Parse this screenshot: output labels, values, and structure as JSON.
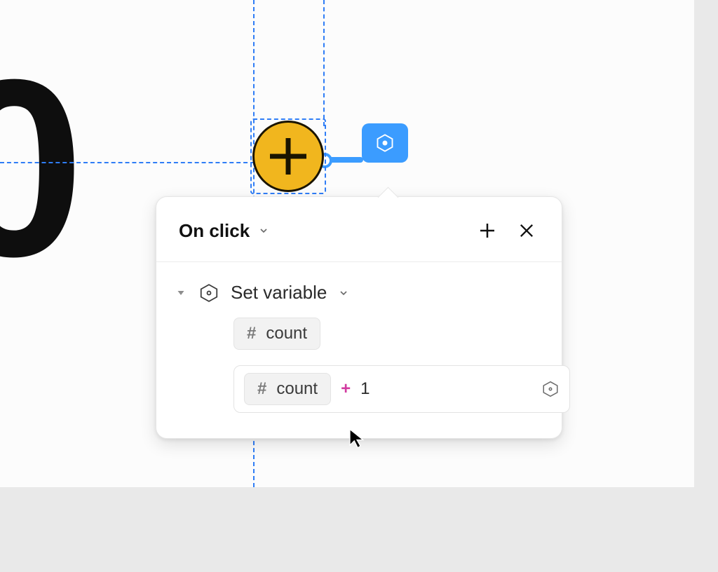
{
  "canvas": {
    "display_value": "0"
  },
  "selected_node": {
    "kind": "add-button"
  },
  "interaction_panel": {
    "trigger": "On click",
    "actions": [
      {
        "type_label": "Set variable",
        "target": {
          "type_glyph": "#",
          "name": "count"
        },
        "expression": {
          "left": {
            "type_glyph": "#",
            "name": "count"
          },
          "operator": "+",
          "right": "1"
        }
      }
    ]
  }
}
